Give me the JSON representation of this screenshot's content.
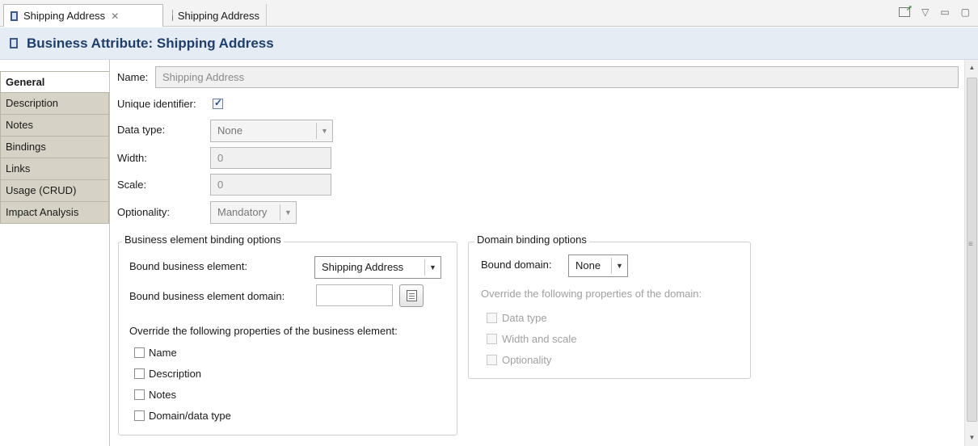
{
  "tabs": [
    {
      "label": "Shipping Address",
      "icon": "entity-icon",
      "active": true
    },
    {
      "label": "Shipping Address",
      "icon": "globe-icon",
      "active": false
    }
  ],
  "header": {
    "title": "Business Attribute: Shipping Address"
  },
  "sidetabs": [
    "General",
    "Description",
    "Notes",
    "Bindings",
    "Links",
    "Usage (CRUD)",
    "Impact Analysis"
  ],
  "general": {
    "name_label": "Name:",
    "name_value": "Shipping Address",
    "unique_label": "Unique identifier:",
    "unique_checked": true,
    "datatype_label": "Data type:",
    "datatype_value": "None",
    "width_label": "Width:",
    "width_value": "0",
    "scale_label": "Scale:",
    "scale_value": "0",
    "optionality_label": "Optionality:",
    "optionality_value": "Mandatory"
  },
  "business_binding": {
    "title": "Business element binding options",
    "bound_label": "Bound business element:",
    "bound_value": "Shipping Address",
    "domain_label": "Bound business element domain:",
    "domain_value": "",
    "override_label": "Override the following properties of the business element:",
    "options": [
      "Name",
      "Description",
      "Notes",
      "Domain/data type"
    ]
  },
  "domain_binding": {
    "title": "Domain binding options",
    "bound_label": "Bound domain:",
    "bound_value": "None",
    "override_label": "Override the following properties of the domain:",
    "options": [
      "Data type",
      "Width and scale",
      "Optionality"
    ]
  },
  "colors": {
    "header_text": "#1e3f6e",
    "tab_bg": "#d6d3c6"
  }
}
